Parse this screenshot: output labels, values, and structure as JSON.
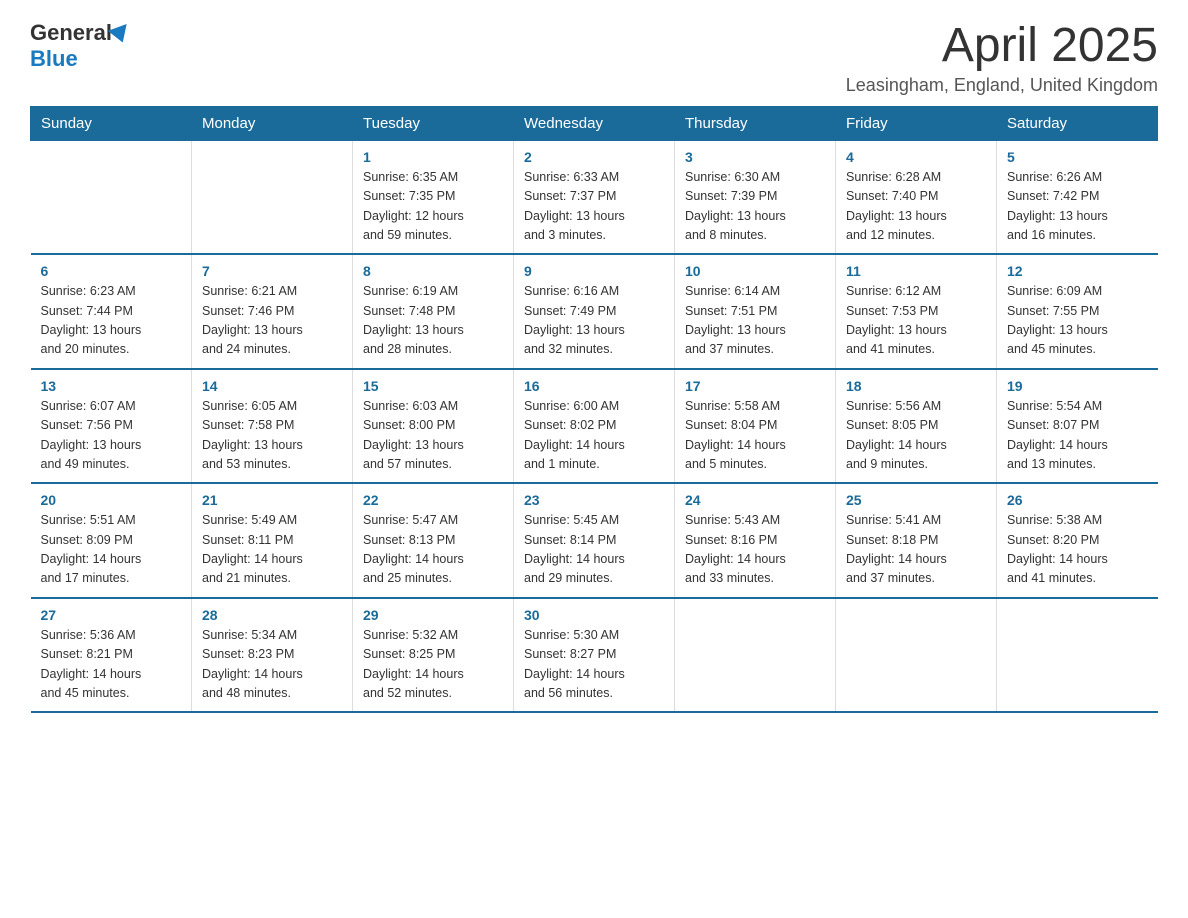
{
  "header": {
    "logo_general": "General",
    "logo_blue": "Blue",
    "title": "April 2025",
    "location": "Leasingham, England, United Kingdom"
  },
  "calendar": {
    "days_of_week": [
      "Sunday",
      "Monday",
      "Tuesday",
      "Wednesday",
      "Thursday",
      "Friday",
      "Saturday"
    ],
    "weeks": [
      [
        {
          "day": "",
          "info": ""
        },
        {
          "day": "",
          "info": ""
        },
        {
          "day": "1",
          "info": "Sunrise: 6:35 AM\nSunset: 7:35 PM\nDaylight: 12 hours\nand 59 minutes."
        },
        {
          "day": "2",
          "info": "Sunrise: 6:33 AM\nSunset: 7:37 PM\nDaylight: 13 hours\nand 3 minutes."
        },
        {
          "day": "3",
          "info": "Sunrise: 6:30 AM\nSunset: 7:39 PM\nDaylight: 13 hours\nand 8 minutes."
        },
        {
          "day": "4",
          "info": "Sunrise: 6:28 AM\nSunset: 7:40 PM\nDaylight: 13 hours\nand 12 minutes."
        },
        {
          "day": "5",
          "info": "Sunrise: 6:26 AM\nSunset: 7:42 PM\nDaylight: 13 hours\nand 16 minutes."
        }
      ],
      [
        {
          "day": "6",
          "info": "Sunrise: 6:23 AM\nSunset: 7:44 PM\nDaylight: 13 hours\nand 20 minutes."
        },
        {
          "day": "7",
          "info": "Sunrise: 6:21 AM\nSunset: 7:46 PM\nDaylight: 13 hours\nand 24 minutes."
        },
        {
          "day": "8",
          "info": "Sunrise: 6:19 AM\nSunset: 7:48 PM\nDaylight: 13 hours\nand 28 minutes."
        },
        {
          "day": "9",
          "info": "Sunrise: 6:16 AM\nSunset: 7:49 PM\nDaylight: 13 hours\nand 32 minutes."
        },
        {
          "day": "10",
          "info": "Sunrise: 6:14 AM\nSunset: 7:51 PM\nDaylight: 13 hours\nand 37 minutes."
        },
        {
          "day": "11",
          "info": "Sunrise: 6:12 AM\nSunset: 7:53 PM\nDaylight: 13 hours\nand 41 minutes."
        },
        {
          "day": "12",
          "info": "Sunrise: 6:09 AM\nSunset: 7:55 PM\nDaylight: 13 hours\nand 45 minutes."
        }
      ],
      [
        {
          "day": "13",
          "info": "Sunrise: 6:07 AM\nSunset: 7:56 PM\nDaylight: 13 hours\nand 49 minutes."
        },
        {
          "day": "14",
          "info": "Sunrise: 6:05 AM\nSunset: 7:58 PM\nDaylight: 13 hours\nand 53 minutes."
        },
        {
          "day": "15",
          "info": "Sunrise: 6:03 AM\nSunset: 8:00 PM\nDaylight: 13 hours\nand 57 minutes."
        },
        {
          "day": "16",
          "info": "Sunrise: 6:00 AM\nSunset: 8:02 PM\nDaylight: 14 hours\nand 1 minute."
        },
        {
          "day": "17",
          "info": "Sunrise: 5:58 AM\nSunset: 8:04 PM\nDaylight: 14 hours\nand 5 minutes."
        },
        {
          "day": "18",
          "info": "Sunrise: 5:56 AM\nSunset: 8:05 PM\nDaylight: 14 hours\nand 9 minutes."
        },
        {
          "day": "19",
          "info": "Sunrise: 5:54 AM\nSunset: 8:07 PM\nDaylight: 14 hours\nand 13 minutes."
        }
      ],
      [
        {
          "day": "20",
          "info": "Sunrise: 5:51 AM\nSunset: 8:09 PM\nDaylight: 14 hours\nand 17 minutes."
        },
        {
          "day": "21",
          "info": "Sunrise: 5:49 AM\nSunset: 8:11 PM\nDaylight: 14 hours\nand 21 minutes."
        },
        {
          "day": "22",
          "info": "Sunrise: 5:47 AM\nSunset: 8:13 PM\nDaylight: 14 hours\nand 25 minutes."
        },
        {
          "day": "23",
          "info": "Sunrise: 5:45 AM\nSunset: 8:14 PM\nDaylight: 14 hours\nand 29 minutes."
        },
        {
          "day": "24",
          "info": "Sunrise: 5:43 AM\nSunset: 8:16 PM\nDaylight: 14 hours\nand 33 minutes."
        },
        {
          "day": "25",
          "info": "Sunrise: 5:41 AM\nSunset: 8:18 PM\nDaylight: 14 hours\nand 37 minutes."
        },
        {
          "day": "26",
          "info": "Sunrise: 5:38 AM\nSunset: 8:20 PM\nDaylight: 14 hours\nand 41 minutes."
        }
      ],
      [
        {
          "day": "27",
          "info": "Sunrise: 5:36 AM\nSunset: 8:21 PM\nDaylight: 14 hours\nand 45 minutes."
        },
        {
          "day": "28",
          "info": "Sunrise: 5:34 AM\nSunset: 8:23 PM\nDaylight: 14 hours\nand 48 minutes."
        },
        {
          "day": "29",
          "info": "Sunrise: 5:32 AM\nSunset: 8:25 PM\nDaylight: 14 hours\nand 52 minutes."
        },
        {
          "day": "30",
          "info": "Sunrise: 5:30 AM\nSunset: 8:27 PM\nDaylight: 14 hours\nand 56 minutes."
        },
        {
          "day": "",
          "info": ""
        },
        {
          "day": "",
          "info": ""
        },
        {
          "day": "",
          "info": ""
        }
      ]
    ]
  }
}
